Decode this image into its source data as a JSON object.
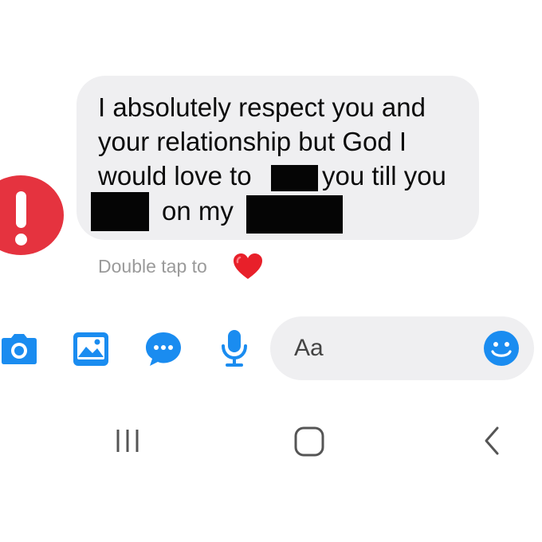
{
  "message": {
    "lines": [
      {
        "text": "I absolutely respect you and"
      },
      {
        "text": "your relationship but God I"
      },
      {
        "text": "would love to",
        "text_after": "you till you"
      },
      {
        "text_after": "on my"
      }
    ]
  },
  "hint": {
    "text": "Double tap to"
  },
  "composer": {
    "placeholder": "Aa"
  },
  "icons": {
    "error": "exclamation-icon",
    "reaction": "heart-icon",
    "camera": "camera-icon",
    "gallery": "image-icon",
    "chat": "chat-bubble-icon",
    "mic": "microphone-icon",
    "emoji": "smiley-icon",
    "recents": "recent-apps-icon",
    "home": "home-icon",
    "back": "back-icon"
  },
  "colors": {
    "accent": "#1a8cf0",
    "error": "#e5333f",
    "heart": "#e8202a",
    "bubble": "#efeff1"
  }
}
